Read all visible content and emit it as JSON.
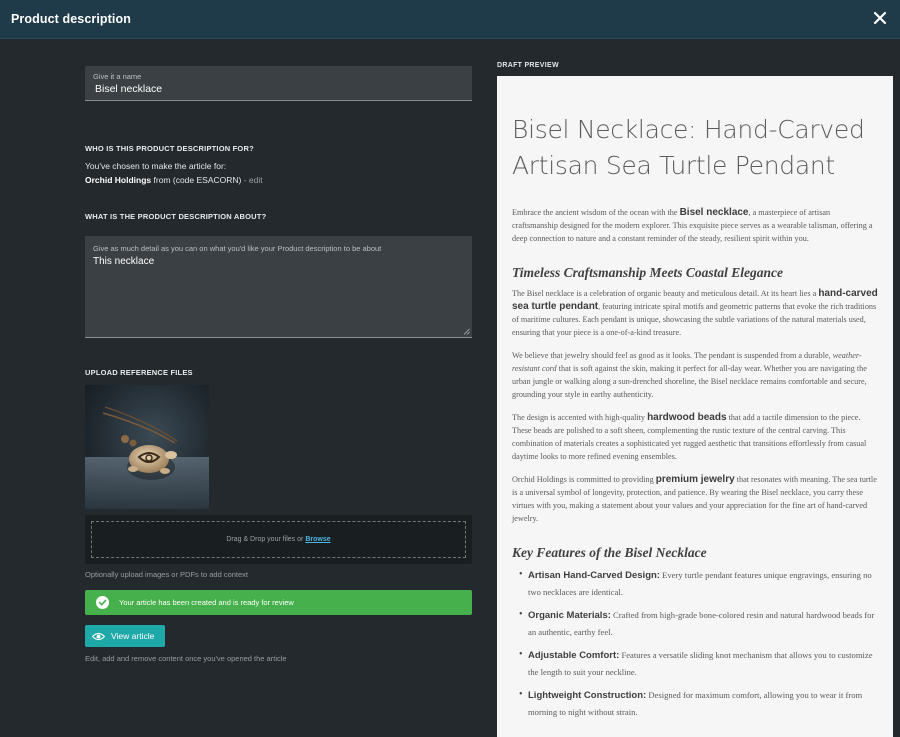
{
  "header": {
    "title": "Product description"
  },
  "name_field": {
    "label": "Give it a name",
    "value": "Bisel necklace"
  },
  "audience": {
    "heading": "WHO IS THIS PRODUCT DESCRIPTION FOR?",
    "line1": "You've chosen to make the article for:",
    "client": "Orchid Holdings",
    "code_text": "from (code ESACORN)",
    "edit_text": "- edit"
  },
  "about": {
    "heading": "WHAT IS THE PRODUCT DESCRIPTION ABOUT?",
    "label": "Give as much detail as you can on what you'd like your Product description to be about",
    "value": "This necklace"
  },
  "upload": {
    "heading": "UPLOAD REFERENCE FILES",
    "drop_text": "Drag & Drop your files or",
    "browse_label": "Browse",
    "help": "Optionally upload images or PDFs to add context"
  },
  "status": {
    "success_message": "Your article has been created and is ready for review"
  },
  "actions": {
    "view_label": "View article",
    "view_help": "Edit, add and remove content once you've opened the article"
  },
  "preview": {
    "label": "DRAFT PREVIEW",
    "title": "Bisel Necklace: Hand-Carved Artisan Sea Turtle Pendant",
    "intro": {
      "a": "Embrace the ancient wisdom of the ocean with the ",
      "b": "Bisel necklace",
      "c": ", a masterpiece of artisan craftsmanship designed for the modern explorer. This exquisite piece serves as a wearable talisman, offering a deep connection to nature and a constant reminder of the steady, resilient spirit within you."
    },
    "h1": "Timeless Craftsmanship Meets Coastal Elegance",
    "p1": {
      "a": "The Bisel necklace is a celebration of organic beauty and meticulous detail. At its heart lies a ",
      "b": "hand-carved sea turtle pendant",
      "c": ", featuring intricate spiral motifs and geometric patterns that evoke the rich traditions of maritime cultures. Each pendant is unique, showcasing the subtle variations of the natural materials used, ensuring that your piece is a one-of-a-kind treasure."
    },
    "p2": {
      "a": "We believe that jewelry should feel as good as it looks. The pendant is suspended from a durable, ",
      "b": "weather-resistant cord",
      "c": " that is soft against the skin, making it perfect for all-day wear. Whether you are navigating the urban jungle or walking along a sun-drenched shoreline, the Bisel necklace remains comfortable and secure, grounding your style in earthy authenticity."
    },
    "p3": {
      "a": "The design is accented with high-quality ",
      "b": "hardwood beads",
      "c": " that add a tactile dimension to the piece. These beads are polished to a soft sheen, complementing the rustic texture of the central carving. This combination of materials creates a sophisticated yet rugged aesthetic that transitions effortlessly from casual daytime looks to more refined evening ensembles."
    },
    "p4": {
      "a": "Orchid Holdings is committed to providing ",
      "b": "premium jewelry",
      "c": " that resonates with meaning. The sea turtle is a universal symbol of longevity, protection, and patience. By wearing the Bisel necklace, you carry these virtues with you, making a statement about your values and your appreciation for the fine art of hand-carved jewelry."
    },
    "h2": "Key Features of the Bisel Necklace",
    "features": [
      {
        "title": "Artisan Hand-Carved Design:",
        "text": " Every turtle pendant features unique engravings, ensuring no two necklaces are identical."
      },
      {
        "title": "Organic Materials:",
        "text": " Crafted from high-grade bone-colored resin and natural hardwood beads for an authentic, earthy feel."
      },
      {
        "title": "Adjustable Comfort:",
        "text": " Features a versatile sliding knot mechanism that allows you to customize the length to suit your neckline."
      },
      {
        "title": "Lightweight Construction:",
        "text": " Designed for maximum comfort, allowing you to wear it from morning to night without strain."
      }
    ]
  },
  "colors": {
    "header_bg": "#1f3b4a",
    "panel_bg": "#23292c",
    "success": "#46b04c",
    "accent": "#1ea9a8",
    "link": "#4fb6e3"
  }
}
